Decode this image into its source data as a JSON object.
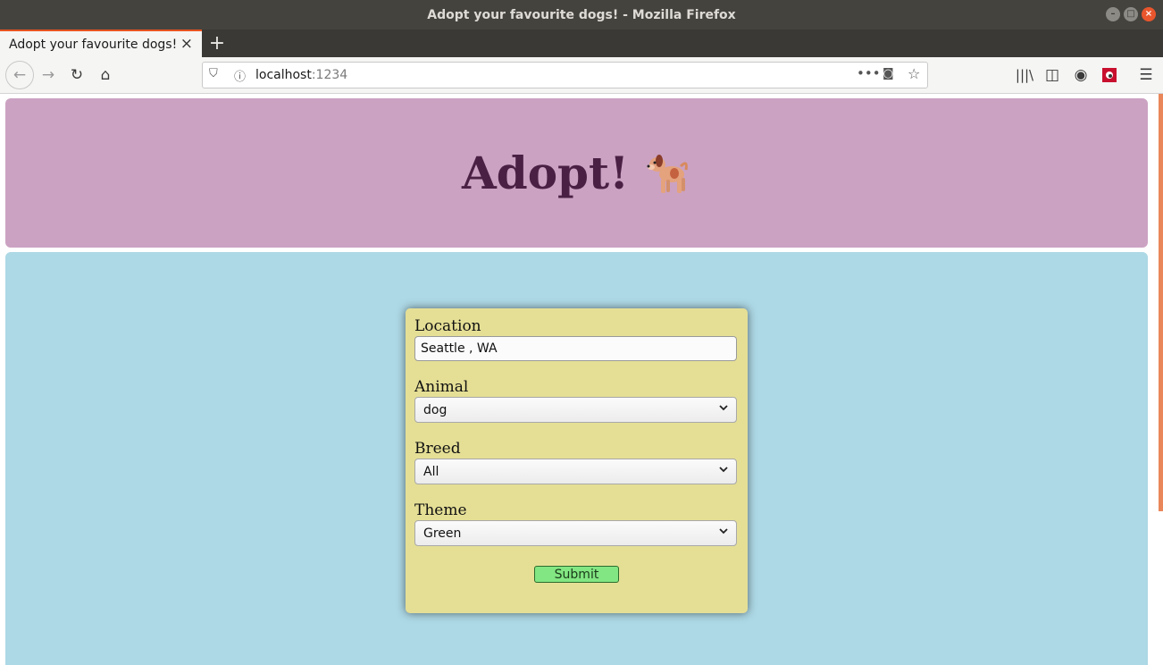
{
  "window": {
    "title": "Adopt your favourite dogs! - Mozilla Firefox"
  },
  "tabs": [
    {
      "label": "Adopt your favourite dogs!"
    }
  ],
  "navbar": {
    "url_host": "localhost",
    "url_port": ":1234"
  },
  "header": {
    "brand": "Adopt!"
  },
  "form": {
    "location": {
      "label": "Location",
      "value": "Seattle , WA"
    },
    "animal": {
      "label": "Animal",
      "value": "dog"
    },
    "breed": {
      "label": "Breed",
      "value": "All"
    },
    "theme": {
      "label": "Theme",
      "value": "Green"
    },
    "submit_label": "Submit"
  },
  "colors": {
    "header_bg": "#cba2c2",
    "main_bg": "#add8e5",
    "form_bg": "#e5df96",
    "submit_bg": "#82e682",
    "brand_text": "#4a2144"
  }
}
